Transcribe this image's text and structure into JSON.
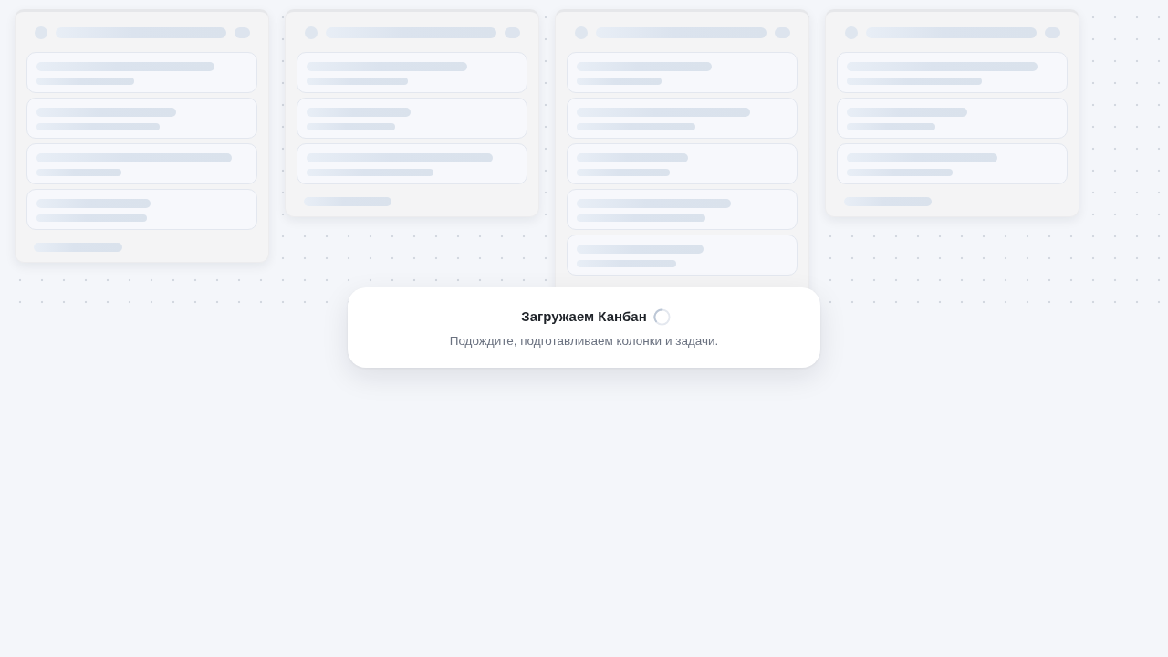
{
  "loading_dialog": {
    "title": "Загружаем Канбан",
    "message": "Подождите, подготавливаем колонки и задачи."
  }
}
